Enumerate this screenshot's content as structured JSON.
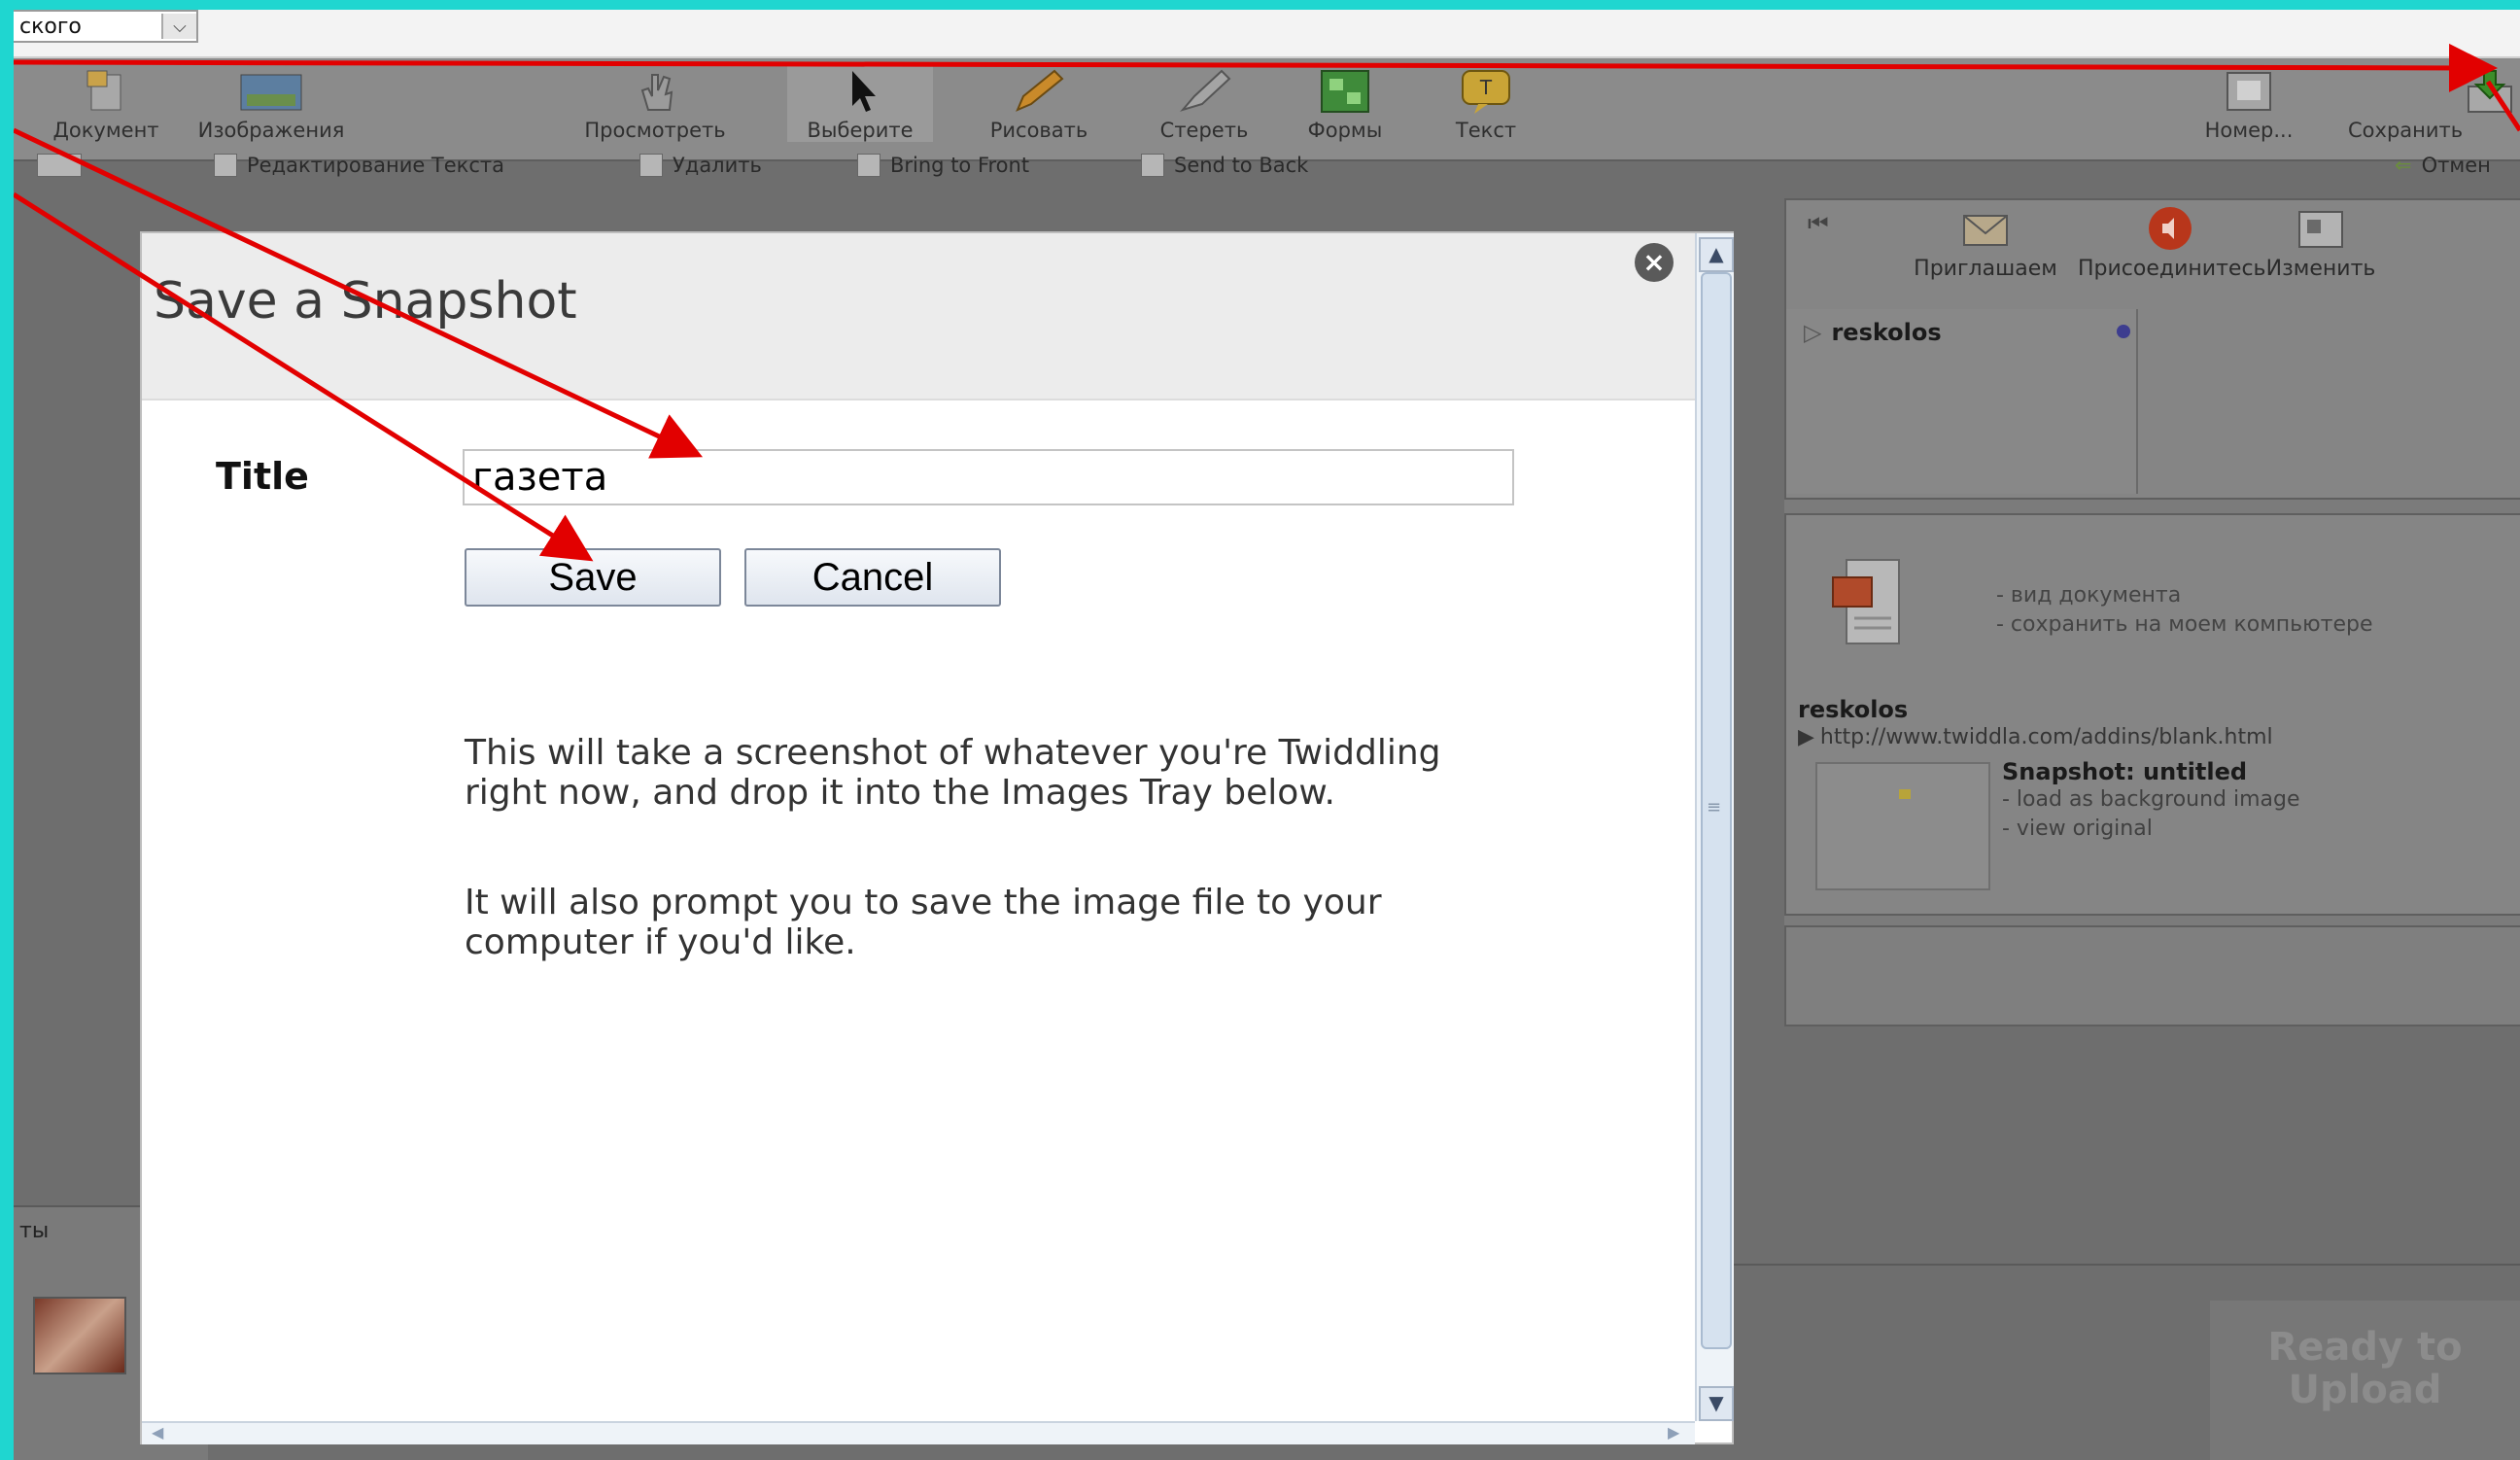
{
  "topbar": {
    "language_value": "ского"
  },
  "toolbar": {
    "tools": [
      {
        "label": "Документ",
        "icon": "document-icon"
      },
      {
        "label": "Изображения",
        "icon": "images-icon"
      },
      {
        "label": "Просмотреть",
        "icon": "hand-icon"
      },
      {
        "label": "Выберите",
        "icon": "pointer-icon"
      },
      {
        "label": "Рисовать",
        "icon": "pencil-icon"
      },
      {
        "label": "Стереть",
        "icon": "eraser-icon"
      },
      {
        "label": "Формы",
        "icon": "shapes-icon"
      },
      {
        "label": "Текст",
        "icon": "text-icon"
      },
      {
        "label": "Номер...",
        "icon": "phone-icon"
      },
      {
        "label": "Сохранить",
        "icon": "save-icon"
      }
    ],
    "sub": {
      "edit_text": "Редактирование Текста",
      "delete": "Удалить",
      "bring_front": "Bring to Front",
      "send_back": "Send to Back",
      "undo": "Отмен"
    }
  },
  "dialog": {
    "title": "Save a Snapshot",
    "title_label": "Title",
    "title_value": "газета",
    "save_label": "Save",
    "cancel_label": "Cancel",
    "para1": "This will take a screenshot of whatever you're Twiddling right now, and drop it into the Images Tray below.",
    "para2": "It will also prompt you to save the image file to your computer if you'd like."
  },
  "right_panel": {
    "invite": "Приглашаем",
    "join": "Присоединитесь",
    "change": "Изменить",
    "user": "reskolos",
    "doc_view": "- вид документа",
    "doc_save": "- сохранить на моем компьютере",
    "user2": "reskolos",
    "url": "http://www.twiddla.com/addins/blank.html",
    "snapshot_title": "Snapshot: untitled",
    "load_bg": "- load as background image",
    "view_original": "- view original"
  },
  "left_panel": {
    "label": "ты"
  },
  "upload": {
    "label": "Ready to Upload"
  }
}
